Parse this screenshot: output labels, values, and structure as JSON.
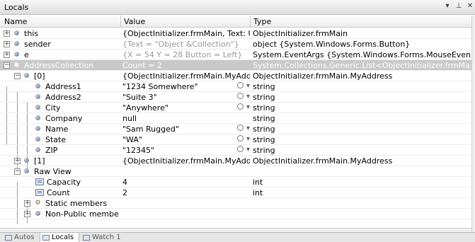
{
  "window": {
    "title": "Locals",
    "controls": [
      "▾",
      "⊥",
      "✕"
    ]
  },
  "columns": {
    "name": "Name",
    "value": "Value",
    "type": "Type"
  },
  "rows": [
    {
      "name": "this",
      "value": "{ObjectInitializer.frmMain, Text: Using Obje",
      "type": "ObjectInitializer.frmMain"
    },
    {
      "name": "sender",
      "value": "{Text = \"Object &Collection\"}",
      "type": "object {System.Windows.Forms.Button}"
    },
    {
      "name": "e",
      "value": "{X = 54 Y = 28 Button = Left}",
      "type": "System.EventArgs {System.Windows.Forms.MouseEventArgs}"
    },
    {
      "name": "AddressCollection",
      "value": "Count = 2",
      "type": "System.Collections.Generic.List<ObjectInitializer.frmMain.MyAddress>"
    },
    {
      "name": "[0]",
      "value": "{ObjectInitializer.frmMain.MyAddress}",
      "type": "ObjectInitializer.frmMain.MyAddress"
    },
    {
      "name": "Address1",
      "value": "\"1234 Somewhere\"",
      "type": "string"
    },
    {
      "name": "Address2",
      "value": "\"Suite 3\"",
      "type": "string"
    },
    {
      "name": "City",
      "value": "\"Anywhere\"",
      "type": "string"
    },
    {
      "name": "Company",
      "value": "null",
      "type": "string"
    },
    {
      "name": "Name",
      "value": "\"Sam Rugged\"",
      "type": "string"
    },
    {
      "name": "State",
      "value": "\"WA\"",
      "type": "string"
    },
    {
      "name": "ZIP",
      "value": "\"12345\"",
      "type": "string"
    },
    {
      "name": "[1]",
      "value": "{ObjectInitializer.frmMain.MyAddress}",
      "type": "ObjectInitializer.frmMain.MyAddress"
    },
    {
      "name": "Raw View",
      "value": "",
      "type": ""
    },
    {
      "name": "Capacity",
      "value": "4",
      "type": "int"
    },
    {
      "name": "Count",
      "value": "2",
      "type": "int"
    },
    {
      "name": "Static members",
      "value": "",
      "type": ""
    },
    {
      "name": "Non-Public members",
      "value": "",
      "type": ""
    }
  ],
  "tabs": [
    {
      "label": "Autos",
      "icon": "autos-icon"
    },
    {
      "label": "Locals",
      "icon": "locals-icon"
    },
    {
      "label": "Watch 1",
      "icon": "watch-icon"
    }
  ]
}
